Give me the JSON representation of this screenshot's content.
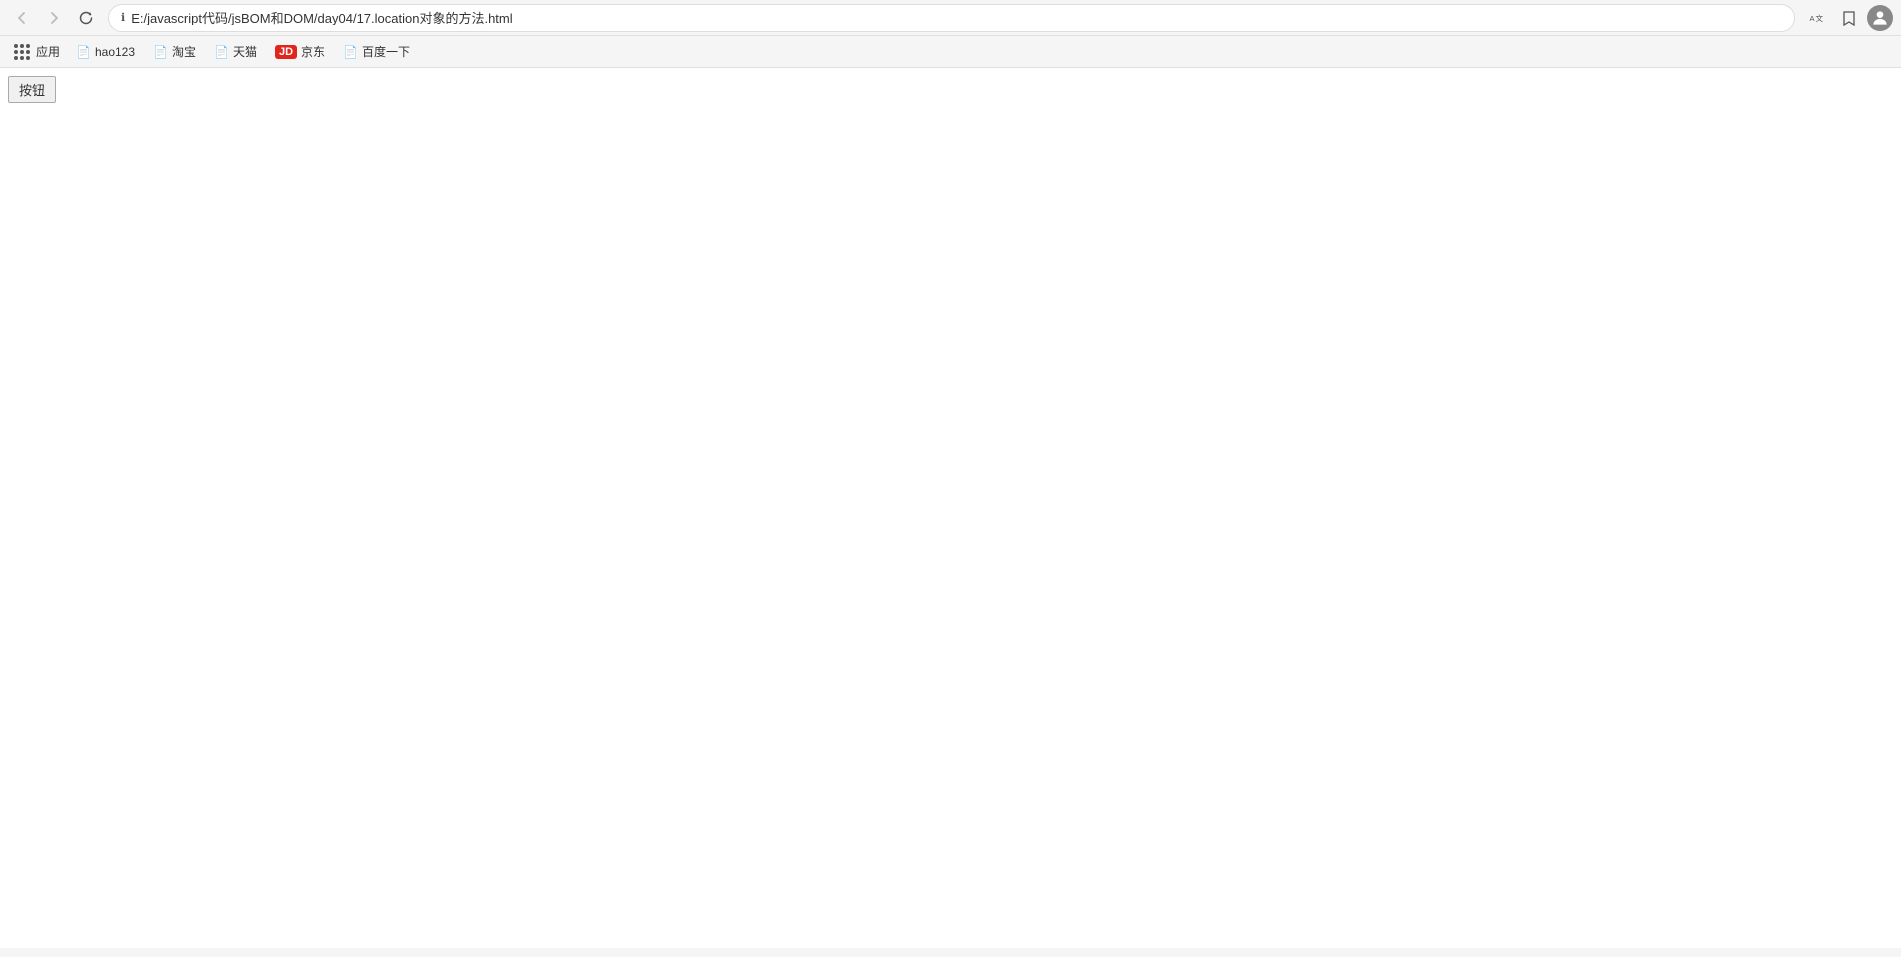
{
  "browser": {
    "title": "E:/javascript代码/jsBOM和DOM/day04/17.location对象的方法.html",
    "address": "E:/javascript代码/jsBOM和DOM/day04/17.location对象的方法.html",
    "back_disabled": true,
    "forward_disabled": true
  },
  "bookmarks": {
    "apps_label": "应用",
    "items": [
      {
        "id": "hao123",
        "label": "hao123",
        "icon": "📄"
      },
      {
        "id": "taobao",
        "label": "淘宝",
        "icon": "📄"
      },
      {
        "id": "tianmao",
        "label": "天猫",
        "icon": "📄"
      },
      {
        "id": "jd",
        "label": "京东",
        "icon": "JD",
        "special": true
      },
      {
        "id": "baidu",
        "label": "百度一下",
        "icon": "📄"
      }
    ]
  },
  "page": {
    "button_label": "按钮"
  }
}
